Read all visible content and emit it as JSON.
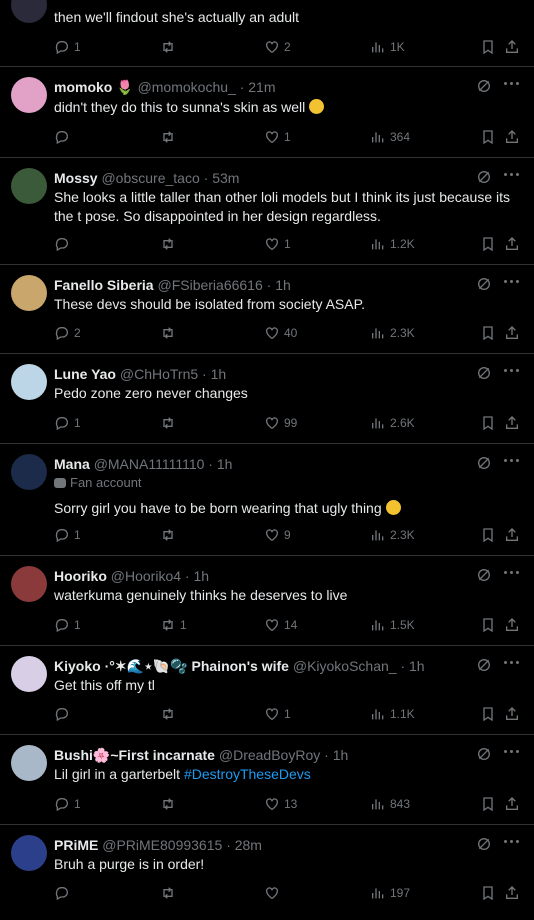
{
  "tweets": [
    {
      "name": "",
      "handle": "",
      "time": "",
      "sub": "",
      "text": "then we'll findout she's actually an adult",
      "hashtag": "",
      "reply": "1",
      "retweet": "",
      "like": "2",
      "views": "1K",
      "avatar_color": "#2a2a3a"
    },
    {
      "name": "momoko",
      "handle": "@momokochu_",
      "time": "· 21m",
      "sub": "",
      "text": "didn't they do this to sunna's skin as well",
      "hashtag": "",
      "reply": "",
      "retweet": "",
      "like": "1",
      "views": "364",
      "avatar_color": "#e2a2c8"
    },
    {
      "name": "Mossy",
      "handle": "@obscure_taco",
      "time": "· 53m",
      "sub": "",
      "text": "She looks a little taller than other loli models but I think its just because its the t pose. So disappointed in her design regardless.",
      "hashtag": "",
      "reply": "",
      "retweet": "",
      "like": "1",
      "views": "1.2K",
      "avatar_color": "#3a5a3a"
    },
    {
      "name": "Fanello Siberia",
      "handle": "@FSiberia66616",
      "time": "· 1h",
      "sub": "",
      "text": "These devs should be isolated from society ASAP.",
      "hashtag": "",
      "reply": "2",
      "retweet": "",
      "like": "40",
      "views": "2.3K",
      "avatar_color": "#c9a66b"
    },
    {
      "name": "Lune Yao",
      "handle": "@ChHoTrn5",
      "time": "· 1h",
      "sub": "",
      "text": "Pedo zone zero never changes",
      "hashtag": "",
      "reply": "1",
      "retweet": "",
      "like": "99",
      "views": "2.6K",
      "avatar_color": "#bcd6e8"
    },
    {
      "name": "Mana",
      "handle": "@MANA11111110",
      "time": "· 1h",
      "sub": "Fan account",
      "text": "Sorry girl you have to be born wearing that ugly thing",
      "hashtag": "",
      "reply": "1",
      "retweet": "",
      "like": "9",
      "views": "2.3K",
      "avatar_color": "#1c2b4a"
    },
    {
      "name": "Hooriko",
      "handle": "@Hooriko4",
      "time": "· 1h",
      "sub": "",
      "text": "waterkuma genuinely thinks he deserves to live",
      "hashtag": "",
      "reply": "1",
      "retweet": "1",
      "like": "14",
      "views": "1.5K",
      "avatar_color": "#8a3a3a"
    },
    {
      "name": "Kiyoko ·°✶🌊⋆🐚🫧 Phainon's wife",
      "handle": "@KiyokoSchan_",
      "time": "· 1h",
      "sub": "",
      "text": "Get this off my tl",
      "hashtag": "",
      "reply": "",
      "retweet": "",
      "like": "1",
      "views": "1.1K",
      "avatar_color": "#d8cfe6"
    },
    {
      "name": "Bushi🌸~First incarnate",
      "handle": "@DreadBoyRoy",
      "time": "· 1h",
      "sub": "",
      "text": "Lil girl in a garterbelt ",
      "hashtag": "#DestroyTheseDevs",
      "reply": "1",
      "retweet": "",
      "like": "13",
      "views": "843",
      "avatar_color": "#a9b8c8"
    },
    {
      "name": "PRiME",
      "handle": "@PRiME80993615",
      "time": "· 28m",
      "sub": "",
      "text": "Bruh a purge is in order!",
      "hashtag": "",
      "reply": "",
      "retweet": "",
      "like": "",
      "views": "197",
      "avatar_color": "#2c3f8a"
    }
  ],
  "icons": [
    "reply-icon",
    "retweet-icon",
    "like-icon",
    "views-icon",
    "bookmark-icon",
    "share-icon",
    "grok-icon",
    "more-icon"
  ],
  "colors": {
    "background": "#000000",
    "text": "#e7e9ea",
    "secondary": "#71767b",
    "link": "#1d9bf0",
    "divider": "#2f3336"
  }
}
